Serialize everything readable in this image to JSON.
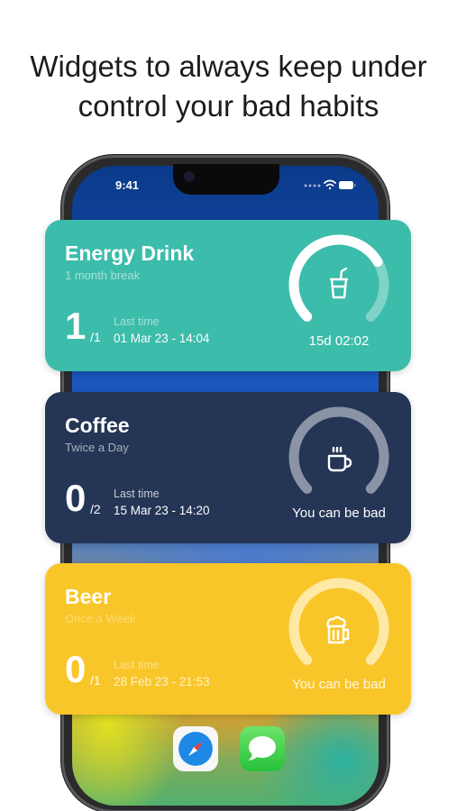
{
  "headline": {
    "line1": "Widgets to always keep under",
    "line2": "control your bad habits"
  },
  "status_bar": {
    "time": "9:41",
    "icons": [
      "signal-dots-icon",
      "wifi-icon",
      "battery-icon"
    ]
  },
  "widgets": [
    {
      "title": "Energy Drink",
      "subtitle": "1 month break",
      "count": "1",
      "total": "/1",
      "last_time_label": "Last time",
      "last_time_value": "01 Mar 23 - 14:04",
      "gauge_caption": "15d 02:02",
      "gauge_progress": 0.72,
      "icon": "cup-with-straw-icon",
      "color": "#3cbcab"
    },
    {
      "title": "Coffee",
      "subtitle": "Twice a Day",
      "count": "0",
      "total": "/2",
      "last_time_label": "Last time",
      "last_time_value": "15 Mar 23 - 14:20",
      "gauge_caption": "You can be bad",
      "gauge_progress": 1.0,
      "icon": "coffee-mug-icon",
      "color": "#243555"
    },
    {
      "title": "Beer",
      "subtitle": "Once a Week",
      "count": "0",
      "total": "/1",
      "last_time_label": "Last time",
      "last_time_value": "28 Feb 23 - 21:53",
      "gauge_caption": "You can be bad",
      "gauge_progress": 1.0,
      "icon": "beer-mug-icon",
      "color": "#f9c62a"
    }
  ],
  "dock": {
    "apps": [
      "safari-icon",
      "messages-icon"
    ]
  }
}
